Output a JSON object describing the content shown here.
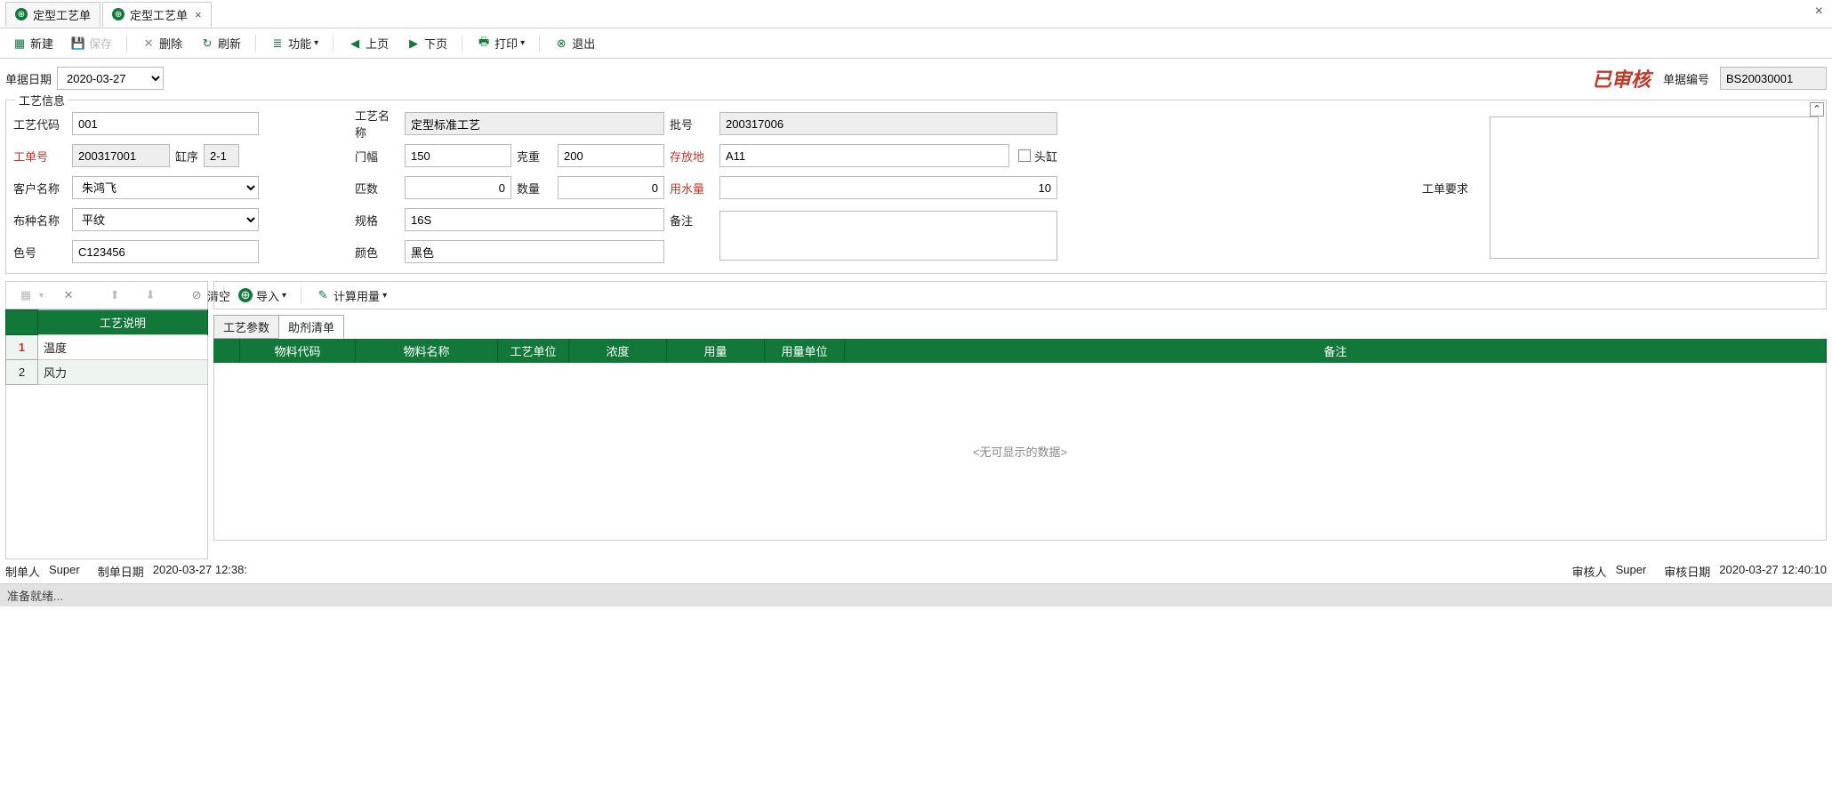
{
  "tabs": {
    "t1": "定型工艺单",
    "t2": "定型工艺单"
  },
  "toolbar": {
    "new": "新建",
    "save": "保存",
    "delete": "删除",
    "refresh": "刷新",
    "func": "功能",
    "prev": "上页",
    "next": "下页",
    "print": "打印",
    "exit": "退出"
  },
  "doc": {
    "date_label": "单据日期",
    "date_value": "2020-03-27",
    "stamp": "已审核",
    "docnum_label": "单据编号",
    "docnum": "BS20030001"
  },
  "section_title": "工艺信息",
  "fields": {
    "code_label": "工艺代码",
    "code": "001",
    "name_label": "工艺名称",
    "name": "定型标准工艺",
    "batch_label": "批号",
    "batch": "200317006",
    "order_label": "工单号",
    "order": "200317001",
    "vat_seq_label": "缸序",
    "vat_seq": "2-1",
    "width_label": "门幅",
    "width": "150",
    "weight_label": "克重",
    "weight": "200",
    "location_label": "存放地",
    "location": "A11",
    "head_vat": "头缸",
    "customer_label": "客户名称",
    "customer": "朱鸿飞",
    "pieces_label": "匹数",
    "pieces": "0",
    "qty_label": "数量",
    "qty": "0",
    "water_label": "用水量",
    "water": "10",
    "req_label": "工单要求",
    "fabric_label": "布种名称",
    "fabric": "平纹",
    "spec_label": "规格",
    "spec": "16S",
    "remark_label": "备注",
    "color_no_label": "色号",
    "color_no": "C123456",
    "color_label": "颜色",
    "color": "黑色"
  },
  "sub_toolbar": {
    "clear": "清空",
    "import": "导入",
    "calc": "计算用量"
  },
  "left_grid": {
    "header": "工艺说明",
    "rows": [
      {
        "n": "1",
        "txt": "温度"
      },
      {
        "n": "2",
        "txt": "风力"
      }
    ]
  },
  "detail_tabs": {
    "params": "工艺参数",
    "aux": "助剂清单"
  },
  "detail_headers": {
    "matcode": "物料代码",
    "matname": "物料名称",
    "unit": "工艺单位",
    "density": "浓度",
    "usage": "用量",
    "usage_unit": "用量单位",
    "remark": "备注"
  },
  "no_data": "<无可显示的数据>",
  "footer": {
    "creator_label": "制单人",
    "creator": "Super",
    "create_date_label": "制单日期",
    "create_date": "2020-03-27 12:38:",
    "auditor_label": "审核人",
    "auditor": "Super",
    "audit_date_label": "审核日期",
    "audit_date": "2020-03-27 12:40:10"
  },
  "status": "准备就绪..."
}
